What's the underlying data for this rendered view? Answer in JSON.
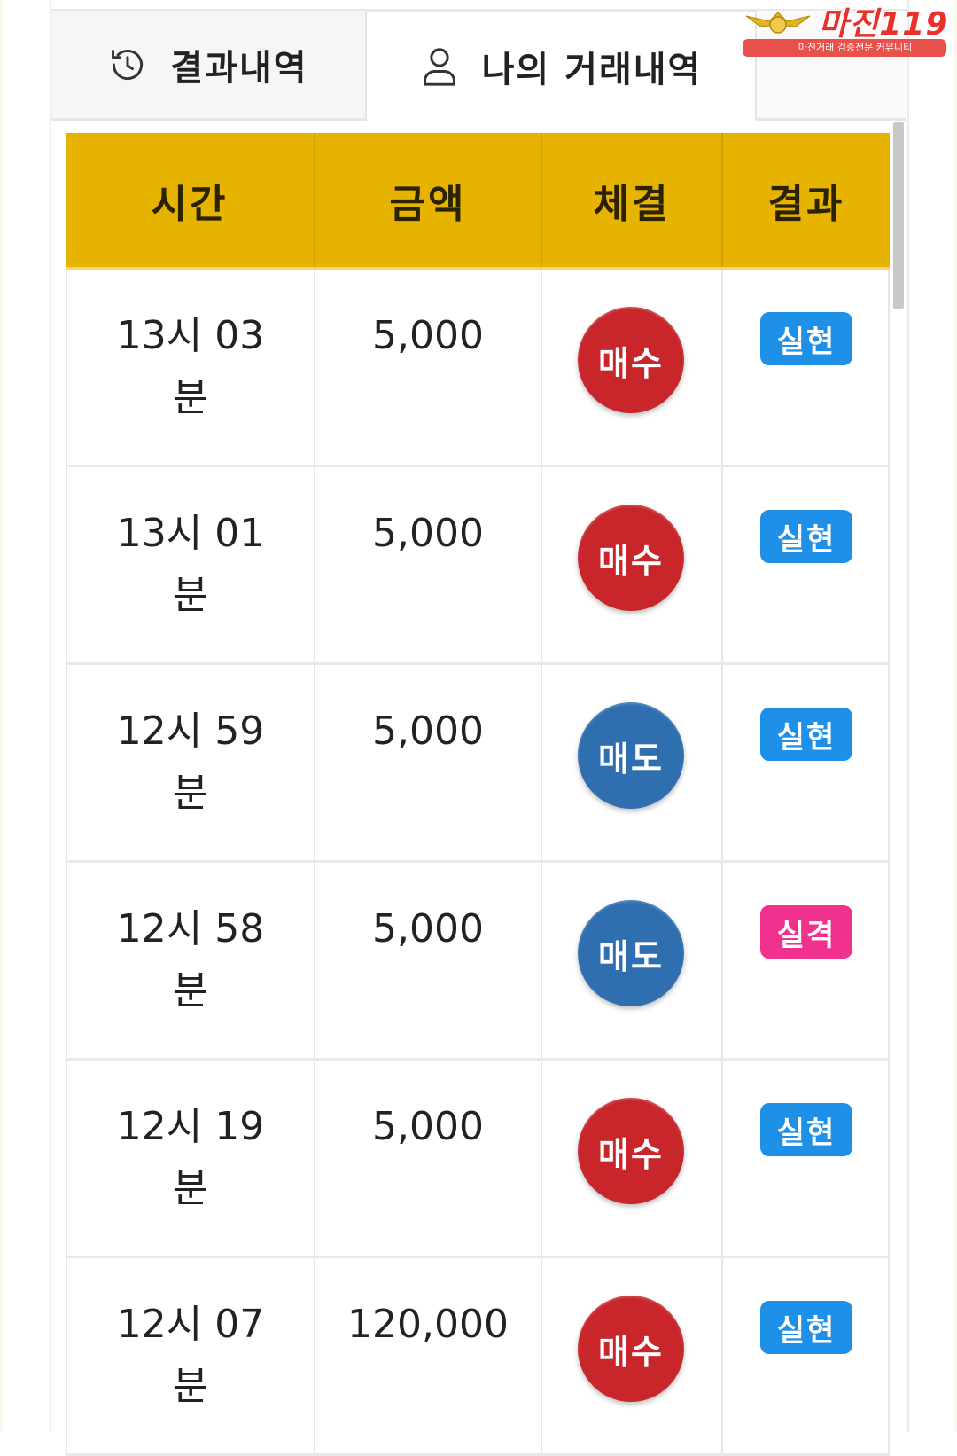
{
  "tabs": {
    "history_label": "결과내역",
    "my_trades_label": "나의 거래내역"
  },
  "logo": {
    "title": "마진119",
    "subtitle": "마진거래 검증전문 커뮤니티"
  },
  "table": {
    "headers": [
      "시간",
      "금액",
      "체결",
      "결과"
    ],
    "rows": [
      {
        "time": "13시 03\n분",
        "amount": "5,000",
        "execution": "매수",
        "result": "실현"
      },
      {
        "time": "13시 01\n분",
        "amount": "5,000",
        "execution": "매수",
        "result": "실현"
      },
      {
        "time": "12시 59\n분",
        "amount": "5,000",
        "execution": "매도",
        "result": "실현"
      },
      {
        "time": "12시 58\n분",
        "amount": "5,000",
        "execution": "매도",
        "result": "실격"
      },
      {
        "time": "12시 19\n분",
        "amount": "5,000",
        "execution": "매수",
        "result": "실현"
      },
      {
        "time": "12시 07\n분",
        "amount": "120,000",
        "execution": "매수",
        "result": "실현"
      }
    ]
  },
  "colors": {
    "header_bg": "#e6b300",
    "buy": "#c8262a",
    "sell": "#2f6fb0",
    "realized": "#1e90e8",
    "disqualified": "#f0318e"
  },
  "icons": {
    "history_tab": "history-icon",
    "my_trades_tab": "user-icon"
  }
}
